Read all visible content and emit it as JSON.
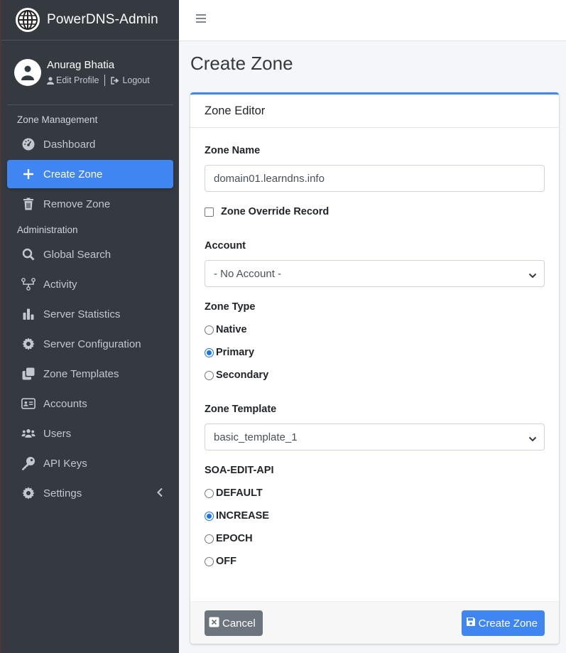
{
  "brand": {
    "name": "PowerDNS-Admin"
  },
  "user": {
    "name": "Anurag Bhatia",
    "edit_profile": "Edit Profile",
    "logout": "Logout"
  },
  "sidebar": {
    "zone_header": "Zone Management",
    "admin_header": "Administration",
    "items": [
      {
        "label": "Dashboard",
        "icon": "dashboard-icon"
      },
      {
        "label": "Create Zone",
        "icon": "plus-icon"
      },
      {
        "label": "Remove Zone",
        "icon": "trash-icon"
      },
      {
        "label": "Global Search",
        "icon": "search-icon"
      },
      {
        "label": "Activity",
        "icon": "activity-icon"
      },
      {
        "label": "Server Statistics",
        "icon": "bar-chart-icon"
      },
      {
        "label": "Server Configuration",
        "icon": "gear-icon"
      },
      {
        "label": "Zone Templates",
        "icon": "clone-icon"
      },
      {
        "label": "Accounts",
        "icon": "id-card-icon"
      },
      {
        "label": "Users",
        "icon": "users-icon"
      },
      {
        "label": "API Keys",
        "icon": "key-icon"
      },
      {
        "label": "Settings",
        "icon": "gear-icon"
      }
    ],
    "active_color": "#3f86f2"
  },
  "page": {
    "title": "Create Zone"
  },
  "card": {
    "header": "Zone Editor",
    "zone_name_label": "Zone Name",
    "zone_name_value": "domain01.learndns.info",
    "override_label": "Zone Override Record",
    "account_label": "Account",
    "account_value": "- No Account -",
    "zone_type_label": "Zone Type",
    "zone_types": [
      "Native",
      "Primary",
      "Secondary"
    ],
    "zone_type_selected": "Primary",
    "template_label": "Zone Template",
    "template_value": "basic_template_1",
    "soa_label": "SOA-EDIT-API",
    "soa_options": [
      "DEFAULT",
      "INCREASE",
      "EPOCH",
      "OFF"
    ],
    "soa_selected": "INCREASE"
  },
  "footer": {
    "cancel": "Cancel",
    "create": "Create Zone"
  }
}
